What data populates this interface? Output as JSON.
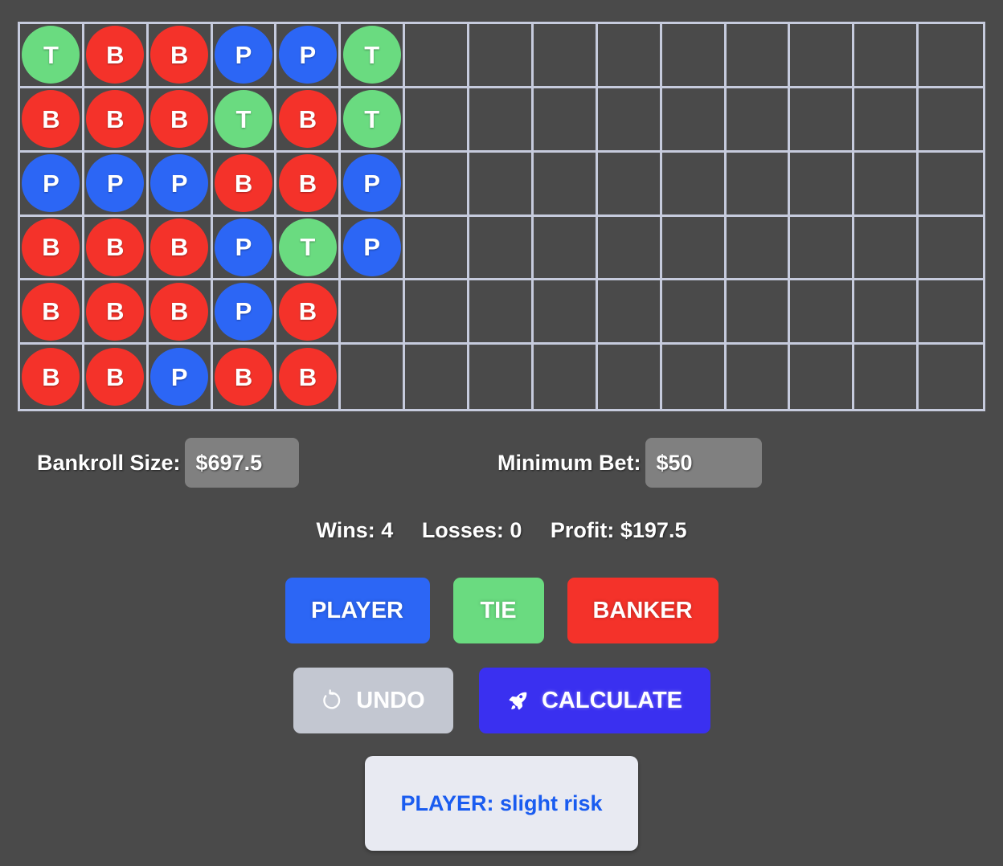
{
  "app": {
    "background_color": "#4a4a4a"
  },
  "colors": {
    "player": "#2c66f5",
    "banker": "#f4322a",
    "tie": "#6adb80",
    "grid_line": "#c6cbdd",
    "input_box": "#808080",
    "undo_button": "#c3c7d1",
    "calculate_button": "#3a30f0",
    "result_panel": "#e8eaf2",
    "result_text": "#1a5cf0"
  },
  "board": {
    "columns": 15,
    "rows": 6,
    "legend": {
      "P": "PLAYER",
      "B": "BANKER",
      "T": "TIE"
    },
    "rows_data": [
      [
        "T",
        "B",
        "B",
        "P",
        "P",
        "T",
        "",
        "",
        "",
        "",
        "",
        "",
        "",
        "",
        ""
      ],
      [
        "B",
        "B",
        "B",
        "T",
        "B",
        "T",
        "",
        "",
        "",
        "",
        "",
        "",
        "",
        "",
        ""
      ],
      [
        "P",
        "P",
        "P",
        "B",
        "B",
        "P",
        "",
        "",
        "",
        "",
        "",
        "",
        "",
        "",
        ""
      ],
      [
        "B",
        "B",
        "B",
        "P",
        "T",
        "P",
        "",
        "",
        "",
        "",
        "",
        "",
        "",
        "",
        ""
      ],
      [
        "B",
        "B",
        "B",
        "P",
        "B",
        "",
        "",
        "",
        "",
        "",
        "",
        "",
        "",
        "",
        ""
      ],
      [
        "B",
        "B",
        "P",
        "B",
        "B",
        "",
        "",
        "",
        "",
        "",
        "",
        "",
        "",
        "",
        ""
      ]
    ]
  },
  "inputs": {
    "bankroll": {
      "label": "Bankroll Size:",
      "value": "$697.5",
      "placeholder": "$697.5"
    },
    "minimum_bet": {
      "label": "Minimum Bet:",
      "value": "$50",
      "placeholder": "$50"
    }
  },
  "stats": {
    "wins": "Wins: 4",
    "losses": "Losses: 0",
    "profit": "Profit: $197.5"
  },
  "bet_buttons": {
    "player": "PLAYER",
    "tie": "TIE",
    "banker": "BANKER"
  },
  "action_buttons": {
    "undo": "UNDO",
    "undo_icon": "undo-rotate-icon",
    "calculate": "CALCULATE",
    "calculate_icon": "rocket-icon"
  },
  "result": {
    "text": "PLAYER: slight risk"
  }
}
